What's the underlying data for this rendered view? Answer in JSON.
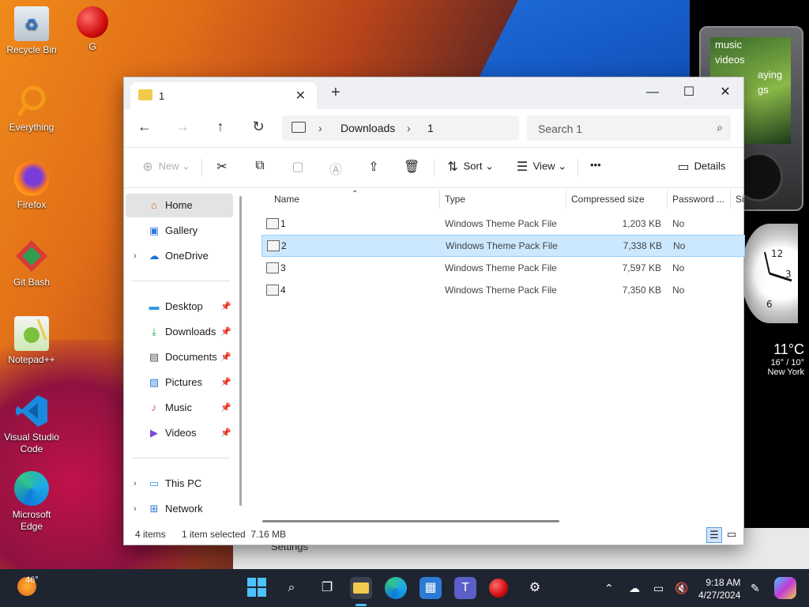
{
  "desktop": {
    "icons": [
      {
        "label": "Recycle Bin",
        "icon": "recycle-bin-icon"
      },
      {
        "label": "G",
        "icon": "g-app-icon"
      },
      {
        "label": "Everything",
        "icon": "everything-icon"
      },
      {
        "label": "Firefox",
        "icon": "firefox-icon"
      },
      {
        "label": "Git Bash",
        "icon": "git-bash-icon"
      },
      {
        "label": "Notepad++",
        "icon": "notepadpp-icon"
      },
      {
        "label": "Visual Studio Code",
        "icon": "vscode-icon"
      },
      {
        "label": "Microsoft Edge",
        "icon": "edge-icon"
      }
    ],
    "gadgets": {
      "player_lines": [
        "music",
        "videos",
        "aying",
        "gs"
      ],
      "weather": {
        "temp": "11°C",
        "range": "16° / 10°",
        "city": "New York"
      }
    }
  },
  "explorer": {
    "tab_title": "1",
    "tab_close": "✕",
    "new_tab": "+",
    "window_buttons": {
      "minimize": "—",
      "maximize": "☐",
      "close": "✕"
    },
    "breadcrumb": [
      "Downloads",
      "1"
    ],
    "search_placeholder": "Search 1",
    "toolbar": {
      "new": "New",
      "sort": "Sort",
      "view": "View",
      "more": "•••",
      "details": "Details"
    },
    "nav": {
      "home": "Home",
      "gallery": "Gallery",
      "onedrive": "OneDrive",
      "desktop": "Desktop",
      "downloads": "Downloads",
      "documents": "Documents",
      "pictures": "Pictures",
      "music": "Music",
      "videos": "Videos",
      "this_pc": "This PC",
      "network": "Network"
    },
    "columns": {
      "name": "Name",
      "type": "Type",
      "compressed_size": "Compressed size",
      "password": "Password ...",
      "more": "Si"
    },
    "files": [
      {
        "name": "1",
        "type": "Windows Theme Pack File",
        "size": "1,203 KB",
        "password": "No"
      },
      {
        "name": "2",
        "type": "Windows Theme Pack File",
        "size": "7,338 KB",
        "password": "No"
      },
      {
        "name": "3",
        "type": "Windows Theme Pack File",
        "size": "7,597 KB",
        "password": "No"
      },
      {
        "name": "4",
        "type": "Windows Theme Pack File",
        "size": "7,350 KB",
        "password": "No"
      }
    ],
    "selected_file": "2",
    "status": {
      "count": "4 items",
      "selection": "1 item selected  7.16 MB"
    }
  },
  "background_window": {
    "title": "Settings"
  },
  "taskbar": {
    "weather_temp": "46°",
    "time": "9:18 AM",
    "date": "4/27/2024"
  }
}
